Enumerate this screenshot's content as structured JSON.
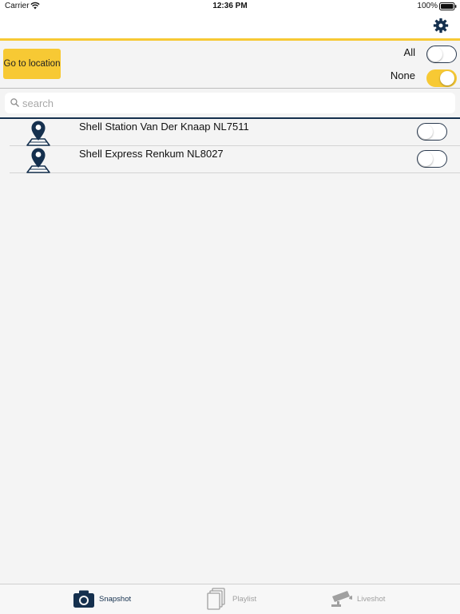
{
  "status_bar": {
    "carrier": "Carrier",
    "time": "12:36 PM",
    "battery": "100%"
  },
  "controls": {
    "go_to_location_label": "Go to location",
    "all_label": "All",
    "none_label": "None",
    "all_on": false,
    "none_on": true
  },
  "search": {
    "placeholder": "search",
    "value": ""
  },
  "stations": [
    {
      "name": "Shell Station Van Der Knaap NL7511",
      "enabled": false
    },
    {
      "name": "Shell Express Renkum NL8027",
      "enabled": false
    }
  ],
  "tabs": [
    {
      "label": "Snapshot",
      "icon": "camera-icon",
      "active": true
    },
    {
      "label": "Playlist",
      "icon": "playlist-icon",
      "active": false
    },
    {
      "label": "Liveshot",
      "icon": "security-camera-icon",
      "active": false
    }
  ],
  "colors": {
    "accent": "#f7c934",
    "navy": "#15304e",
    "inactive": "#a0a0a0"
  }
}
